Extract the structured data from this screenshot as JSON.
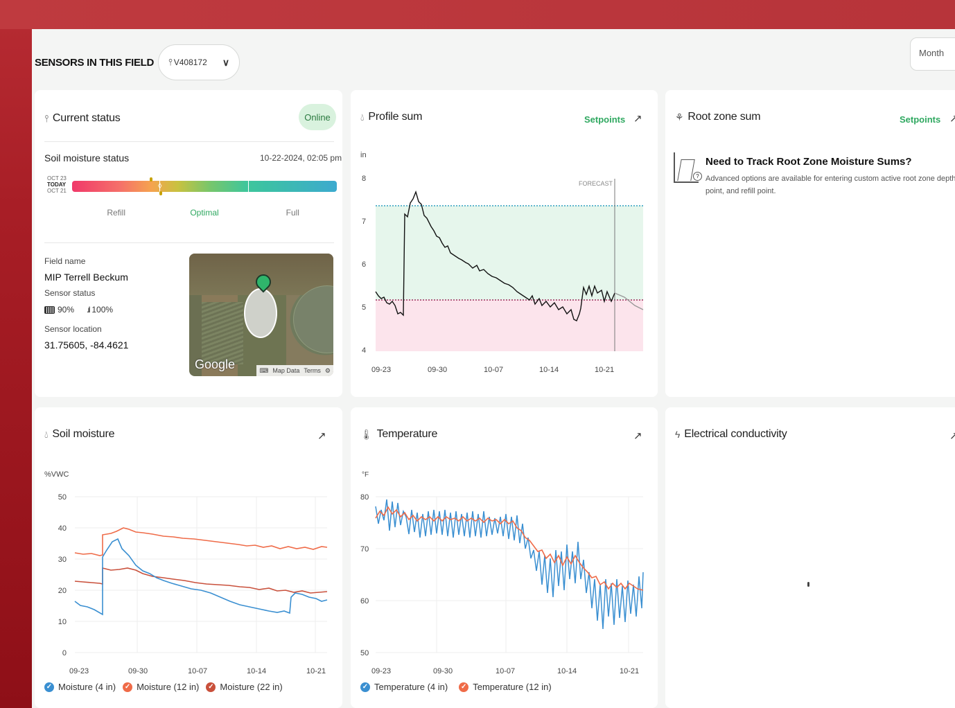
{
  "header": {
    "sensors_label": "SENSORS IN THIS FIELD",
    "sensor_id": "V408172",
    "range_label": "Month"
  },
  "status_card": {
    "title": "Current status",
    "badge": "Online",
    "moisture_title": "Soil moisture status",
    "timestamp": "10-22-2024, 02:05 pm",
    "gauge_dates": [
      "OCT 23",
      "TODAY",
      "OCT 21"
    ],
    "zones": [
      "Refill",
      "Optimal",
      "Full"
    ],
    "field_name_label": "Field name",
    "field_name": "MIP Terrell Beckum",
    "sensor_status_label": "Sensor status",
    "battery": "90%",
    "signal": "100%",
    "location_label": "Sensor location",
    "location": "31.75605, -84.4621",
    "map_logo": "Google",
    "map_links": [
      "Map Data",
      "Terms"
    ]
  },
  "profile_card": {
    "title": "Profile sum",
    "setpoints": "Setpoints",
    "unit": "in",
    "forecast": "FORECAST",
    "y_ticks": [
      "8",
      "7",
      "6",
      "5",
      "4"
    ],
    "x_ticks": [
      "09-23",
      "09-30",
      "10-07",
      "10-14",
      "10-21"
    ]
  },
  "rootzone_card": {
    "title": "Root zone sum",
    "setpoints": "Setpoints",
    "heading": "Need to Track Root Zone Moisture Sums?",
    "line1": "Advanced options are available for entering custom active root zone depth, w",
    "line2": "point, and refill point."
  },
  "moisture_card": {
    "title": "Soil moisture",
    "unit": "%VWC",
    "y_ticks": [
      "50",
      "40",
      "30",
      "20",
      "10",
      "0"
    ],
    "x_ticks": [
      "09-23",
      "09-30",
      "10-07",
      "10-14",
      "10-21"
    ],
    "legend": [
      "Moisture (4 in)",
      "Moisture (12 in)",
      "Moisture (22 in)"
    ]
  },
  "temperature_card": {
    "title": "Temperature",
    "unit": "°F",
    "y_ticks": [
      "80",
      "70",
      "60",
      "50"
    ],
    "x_ticks": [
      "09-23",
      "09-30",
      "10-07",
      "10-14",
      "10-21"
    ],
    "legend": [
      "Temperature (4 in)",
      "Temperature (12 in)"
    ]
  },
  "ec_card": {
    "title": "Electrical conductivity"
  },
  "colors": {
    "accent_green": "#2fa860",
    "series_blue": "#3a8fd1",
    "series_orange": "#ef6b48",
    "series_darkred": "#c9503b",
    "optimal_band": "#e6f6ec",
    "refill_band": "#fce4ec"
  }
}
